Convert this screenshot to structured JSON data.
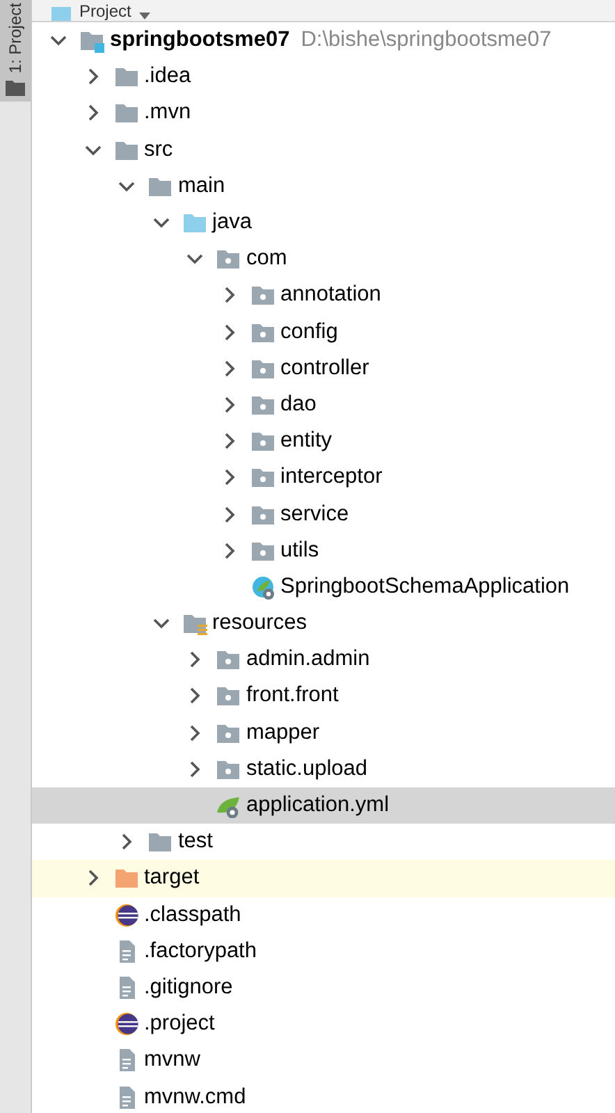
{
  "side_strip": {
    "tab_label": "1: Project"
  },
  "panel_header": {
    "title": "Project"
  },
  "tree": [
    {
      "name": "springbootsme07",
      "kind": "project",
      "path": "D:\\bishe\\springbootsme07",
      "expanded": true,
      "selected": false,
      "children": [
        {
          "name": ".idea",
          "kind": "folder",
          "expanded": false,
          "selected": false
        },
        {
          "name": ".mvn",
          "kind": "folder",
          "expanded": false,
          "selected": false
        },
        {
          "name": "src",
          "kind": "folder",
          "expanded": true,
          "selected": false,
          "children": [
            {
              "name": "main",
              "kind": "folder",
              "expanded": true,
              "selected": false,
              "children": [
                {
                  "name": "java",
                  "kind": "source-folder",
                  "expanded": true,
                  "selected": false,
                  "children": [
                    {
                      "name": "com",
                      "kind": "package",
                      "expanded": true,
                      "selected": false,
                      "children": [
                        {
                          "name": "annotation",
                          "kind": "package",
                          "expanded": false,
                          "selected": false
                        },
                        {
                          "name": "config",
                          "kind": "package",
                          "expanded": false,
                          "selected": false
                        },
                        {
                          "name": "controller",
                          "kind": "package",
                          "expanded": false,
                          "selected": false
                        },
                        {
                          "name": "dao",
                          "kind": "package",
                          "expanded": false,
                          "selected": false
                        },
                        {
                          "name": "entity",
                          "kind": "package",
                          "expanded": false,
                          "selected": false
                        },
                        {
                          "name": "interceptor",
                          "kind": "package",
                          "expanded": false,
                          "selected": false
                        },
                        {
                          "name": "service",
                          "kind": "package",
                          "expanded": false,
                          "selected": false
                        },
                        {
                          "name": "utils",
                          "kind": "package",
                          "expanded": false,
                          "selected": false
                        },
                        {
                          "name": "SpringbootSchemaApplication",
                          "kind": "spring-app",
                          "selected": false
                        }
                      ]
                    }
                  ]
                },
                {
                  "name": "resources",
                  "kind": "resource-folder",
                  "expanded": true,
                  "selected": false,
                  "children": [
                    {
                      "name": "admin.admin",
                      "kind": "package",
                      "expanded": false,
                      "selected": false
                    },
                    {
                      "name": "front.front",
                      "kind": "package",
                      "expanded": false,
                      "selected": false
                    },
                    {
                      "name": "mapper",
                      "kind": "package",
                      "expanded": false,
                      "selected": false
                    },
                    {
                      "name": "static.upload",
                      "kind": "package",
                      "expanded": false,
                      "selected": false
                    },
                    {
                      "name": "application.yml",
                      "kind": "spring-config",
                      "selected": true
                    }
                  ]
                }
              ]
            },
            {
              "name": "test",
              "kind": "folder",
              "expanded": false,
              "selected": false
            }
          ]
        },
        {
          "name": "target",
          "kind": "excluded-folder",
          "expanded": false,
          "selected": false
        },
        {
          "name": ".classpath",
          "kind": "eclipse-file",
          "selected": false
        },
        {
          "name": ".factorypath",
          "kind": "text-file",
          "selected": false
        },
        {
          "name": ".gitignore",
          "kind": "text-file",
          "selected": false
        },
        {
          "name": ".project",
          "kind": "eclipse-file",
          "selected": false
        },
        {
          "name": "mvnw",
          "kind": "text-file",
          "selected": false
        },
        {
          "name": "mvnw.cmd",
          "kind": "text-file",
          "selected": false
        }
      ]
    }
  ]
}
